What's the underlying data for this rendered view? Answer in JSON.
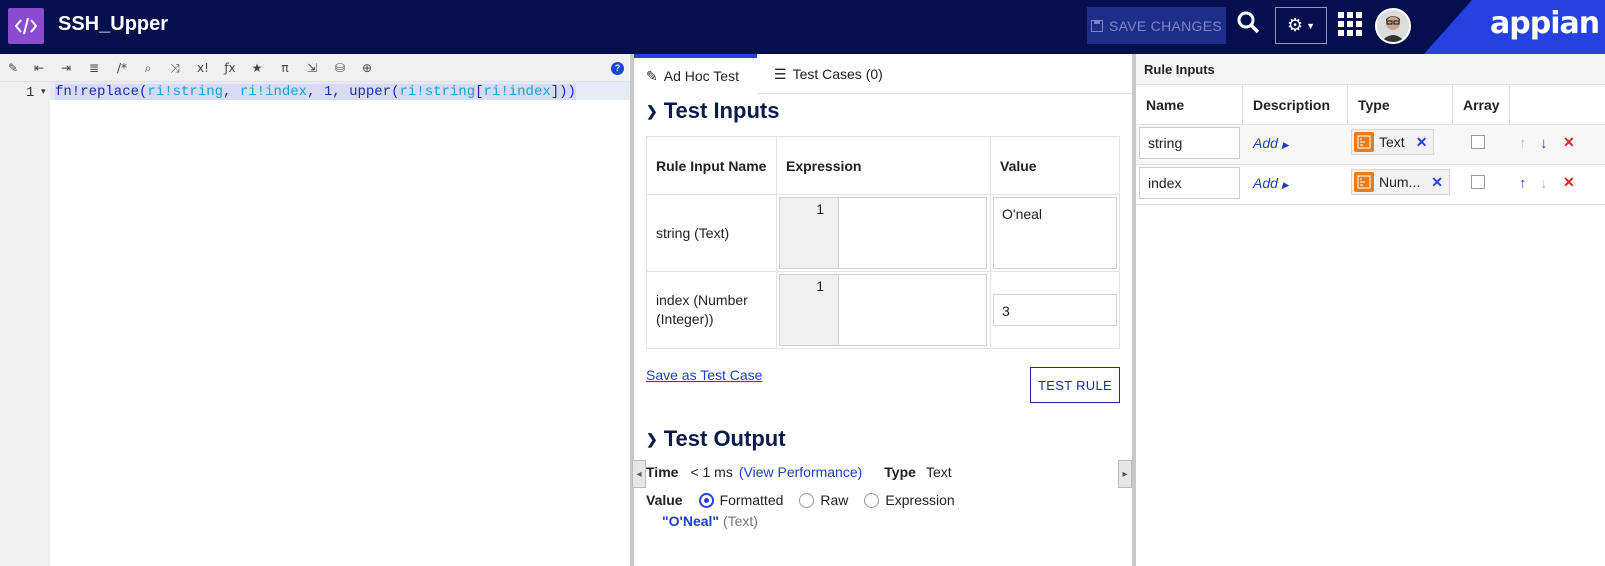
{
  "header": {
    "title": "SSH_Upper",
    "save_label": "SAVE CHANGES",
    "brand": "appian"
  },
  "editor": {
    "line_number": "1",
    "code": {
      "p1": "fn!replace(",
      "ri1": "ri!string",
      "p2": ", ",
      "ri2": "ri!index",
      "p3": ", 1, upper(",
      "ri3": "ri!string",
      "p4": "[",
      "ri4": "ri!index",
      "p5": "]))"
    },
    "help": "?"
  },
  "tabs": [
    {
      "label": "Ad Hoc Test"
    },
    {
      "label": "Test Cases (0)"
    }
  ],
  "test_inputs": {
    "heading": "Test Inputs",
    "col_name": "Rule Input Name",
    "col_expr": "Expression",
    "col_value": "Value",
    "rows": [
      {
        "name": "string (Text)",
        "line": "1",
        "value": "O'neal"
      },
      {
        "name": "index (Number (Integer))",
        "line": "1",
        "value": "3"
      }
    ],
    "save_link": "Save as Test Case",
    "test_button": "TEST RULE"
  },
  "test_output": {
    "heading": "Test Output",
    "time_label": "Time",
    "time_value": "< 1 ms",
    "perf_link": "(View Performance)",
    "type_label": "Type",
    "type_value": "Text",
    "value_label": "Value",
    "options": [
      "Formatted",
      "Raw",
      "Expression"
    ],
    "selected": "Formatted",
    "result": "\"O'Neal\"",
    "result_type": "(Text)"
  },
  "rule_inputs": {
    "heading": "Rule Inputs",
    "columns": [
      "Name",
      "Description",
      "Type",
      "Array"
    ],
    "rows": [
      {
        "name": "string",
        "desc": "Add",
        "type": "Text"
      },
      {
        "name": "index",
        "desc": "Add",
        "type": "Num..."
      }
    ]
  }
}
